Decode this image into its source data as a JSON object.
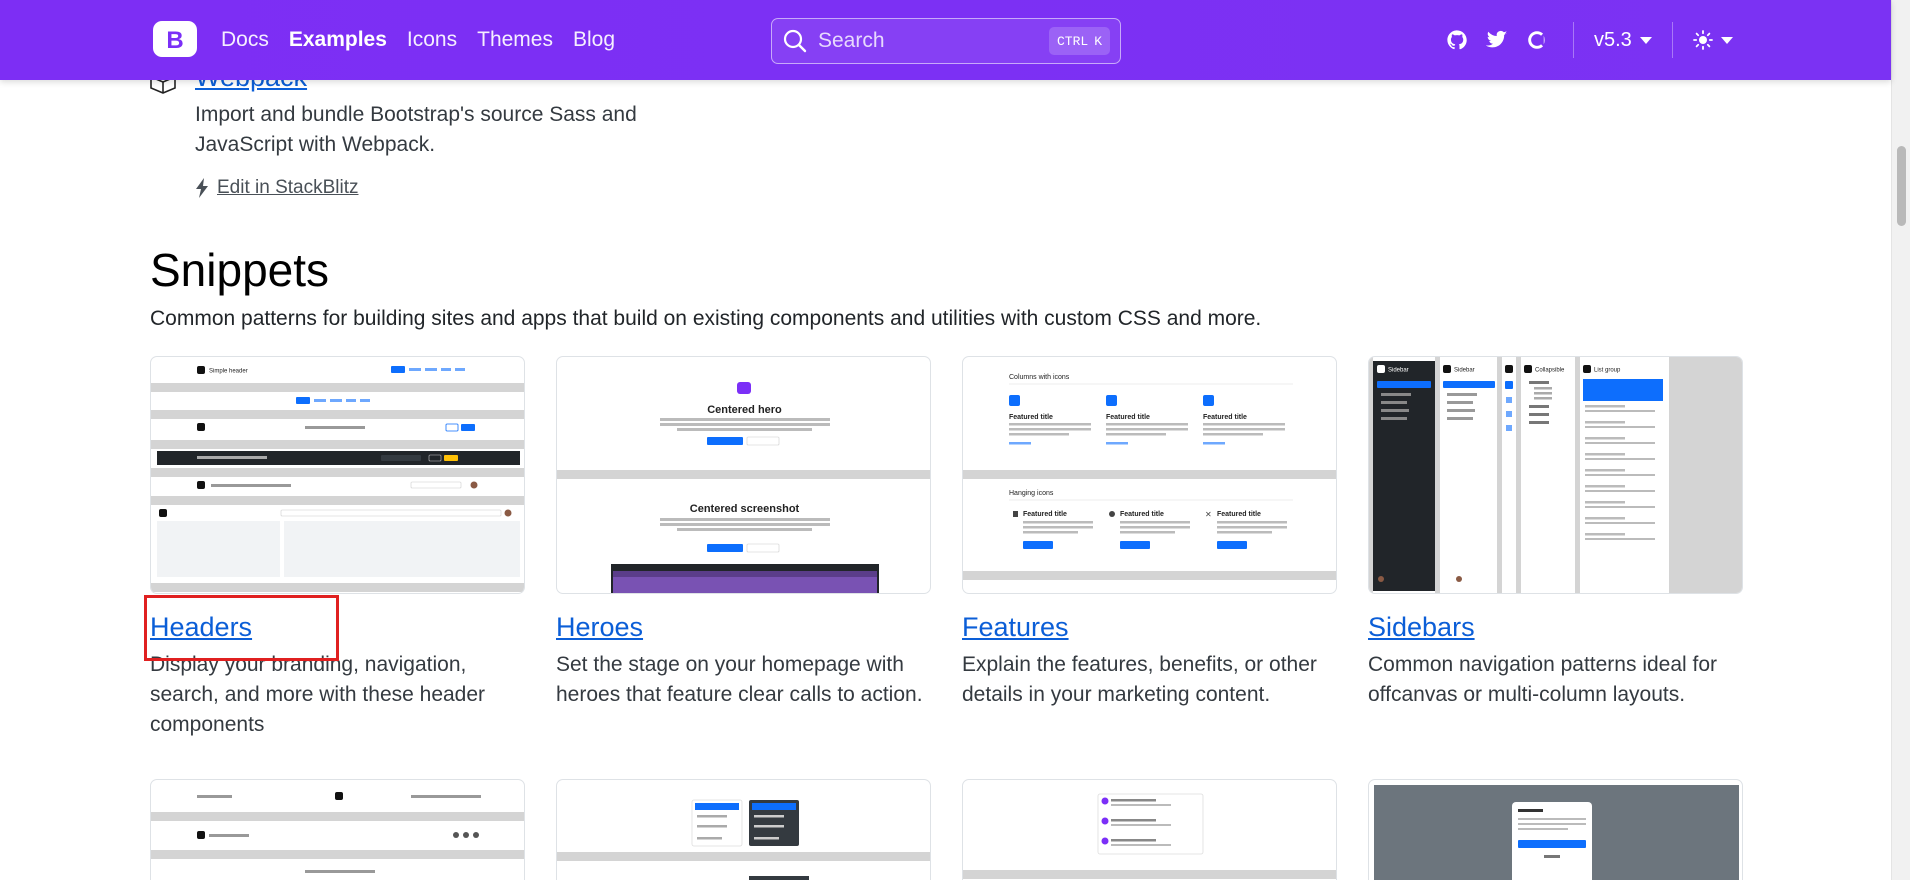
{
  "navbar": {
    "brand_letter": "B",
    "links": [
      {
        "label": "Docs",
        "active": false
      },
      {
        "label": "Examples",
        "active": true
      },
      {
        "label": "Icons",
        "active": false
      },
      {
        "label": "Themes",
        "active": false
      },
      {
        "label": "Blog",
        "active": false
      }
    ],
    "search": {
      "placeholder": "Search",
      "shortcut_mod": "CTRL",
      "shortcut_key": "K"
    },
    "icons": [
      "github-icon",
      "twitter-icon",
      "opencollective-icon"
    ],
    "version": "v5.3",
    "accent": "#7b2ff7"
  },
  "webpack": {
    "title": "Webpack",
    "description": "Import and bundle Bootstrap's source Sass and JavaScript with Webpack.",
    "edit_label": "Edit in StackBlitz"
  },
  "snippets": {
    "title": "Snippets",
    "lead": "Common patterns for building sites and apps that build on existing components and utilities with custom CSS and more.",
    "cards": [
      {
        "title": "Headers",
        "description": "Display your branding, navigation, search, and more with these header components"
      },
      {
        "title": "Heroes",
        "description": "Set the stage on your homepage with heroes that feature clear calls to action."
      },
      {
        "title": "Features",
        "description": "Explain the features, benefits, or other details in your marketing content."
      },
      {
        "title": "Sidebars",
        "description": "Common navigation patterns ideal for offcanvas or multi-column layouts."
      }
    ]
  },
  "thumbs": {
    "headers": {
      "simple_header": "Simple header"
    },
    "heroes": {
      "hero1": "Centered hero",
      "hero2": "Centered screenshot",
      "primary": "Primary button",
      "secondary": "Secondary"
    },
    "features": {
      "section1": "Columns with icons",
      "section2": "Hanging icons",
      "item": "Featured title",
      "btn": "Primary button"
    },
    "sidebars": {
      "brand": "Sidebar",
      "collapsible": "Collapsible",
      "list": "List group"
    }
  }
}
